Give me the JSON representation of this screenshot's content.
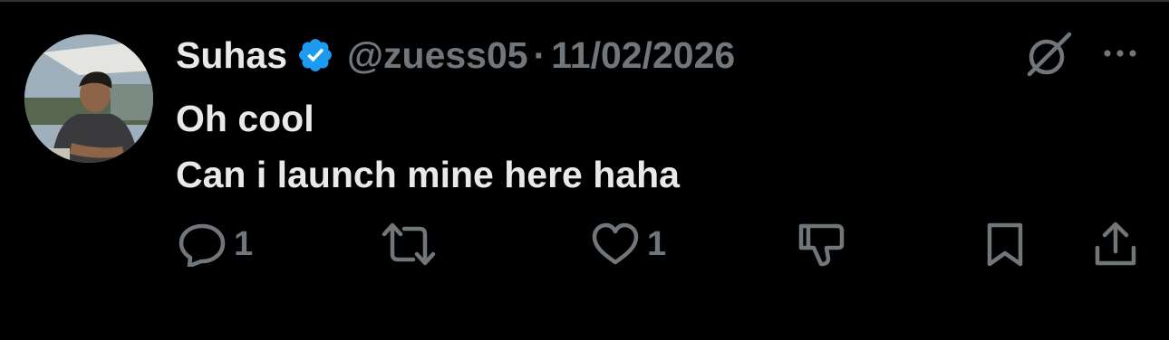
{
  "post": {
    "author_name": "Suhas",
    "verified": true,
    "handle": "@zuess05",
    "separator": "·",
    "date": "11/02/2026",
    "lines": [
      "Oh cool",
      "Can i launch mine here haha"
    ]
  },
  "actions": {
    "reply_count": "1",
    "like_count": "1"
  },
  "icons": {
    "verified": "verified-badge-icon",
    "grok": "grok-icon",
    "more": "more-options-icon",
    "reply": "reply-icon",
    "repost": "repost-icon",
    "like": "heart-icon",
    "dislike": "thumbs-down-icon",
    "bookmark": "bookmark-icon",
    "share": "share-icon"
  },
  "colors": {
    "background": "#000000",
    "primary_text": "#e7e9ea",
    "secondary_text": "#71767b",
    "verified_blue": "#1d9bf0"
  }
}
